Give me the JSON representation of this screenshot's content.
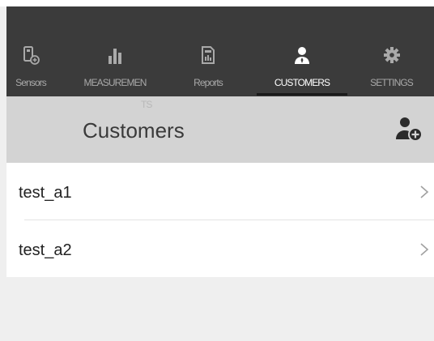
{
  "nav": {
    "tabs": [
      {
        "label": "Sensors",
        "icon": "sensor-icon",
        "active": false
      },
      {
        "label": "MEASUREMEN",
        "icon": "bar-chart-icon",
        "active": false
      },
      {
        "label": "Reports",
        "icon": "report-icon",
        "active": false
      },
      {
        "label": "CUSTOMERS",
        "icon": "person-icon",
        "active": true
      },
      {
        "label": "SETTINGS",
        "icon": "gear-icon",
        "active": false
      }
    ],
    "overflow_text": "TS"
  },
  "header": {
    "title": "Customers",
    "add_icon": "add-person-icon"
  },
  "customers": [
    {
      "name": "test_a1"
    },
    {
      "name": "test_a2"
    }
  ],
  "colors": {
    "nav_bg": "#3b3b3b",
    "header_bg": "#d3d3d3",
    "page_bg": "#efefef",
    "active_text": "#ffffff",
    "inactive_text": "#a9a9a9"
  }
}
